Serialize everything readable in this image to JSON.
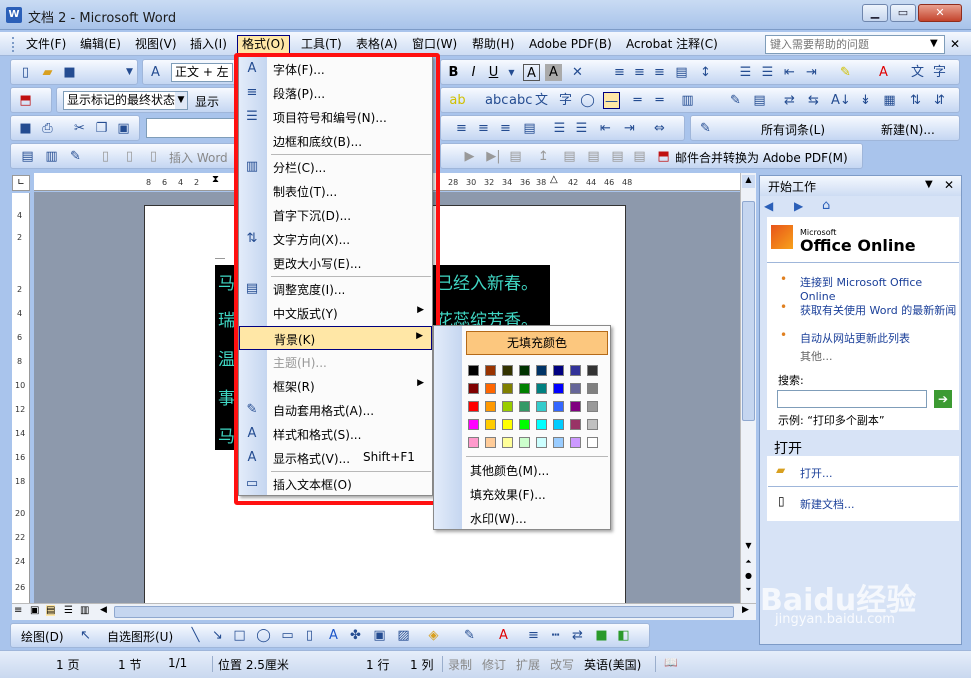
{
  "window": {
    "title": "文档 2 - Microsoft Word",
    "app_icon": "W"
  },
  "menubar": {
    "items": [
      "文件(F)",
      "编辑(E)",
      "视图(V)",
      "插入(I)",
      "格式(O)",
      "工具(T)",
      "表格(A)",
      "窗口(W)",
      "帮助(H)",
      "Adobe PDF(B)",
      "Acrobat 注释(C)"
    ],
    "help_placeholder": "键入需要帮助的问题"
  },
  "toolbar": {
    "style_value": "正文 + 左",
    "markup_combo": "显示标记的最终状态",
    "show_button": "显示",
    "all_entries": "所有词条(L)",
    "new_button": "新建(N)...",
    "insert_word": "插入 Word",
    "mail_merge_pdf": "邮件合并转换为 Adobe PDF(M)"
  },
  "ruler": {
    "h_ticks": [
      "8",
      "6",
      "4",
      "2",
      "28",
      "30",
      "32",
      "34",
      "36",
      "38",
      "42",
      "44",
      "46",
      "48"
    ],
    "v_ticks": [
      "4",
      "2",
      "2",
      "4",
      "6",
      "8",
      "10",
      "12",
      "14",
      "16",
      "18",
      "20",
      "22",
      "24",
      "26"
    ]
  },
  "document": {
    "lines": [
      "马",
      "瑞",
      "温",
      "事",
      "马"
    ],
    "right_fragments": [
      "已经入新春。",
      "花蕊绽芳香。"
    ]
  },
  "format_menu": {
    "items": [
      {
        "label": "字体(F)...",
        "icon": "A"
      },
      {
        "label": "段落(P)...",
        "icon": "≡"
      },
      {
        "label": "项目符号和编号(N)...",
        "icon": "☰"
      },
      {
        "label": "边框和底纹(B)...",
        "icon": ""
      },
      {
        "label": "分栏(C)...",
        "icon": "▥"
      },
      {
        "label": "制表位(T)...",
        "icon": ""
      },
      {
        "label": "首字下沉(D)...",
        "icon": ""
      },
      {
        "label": "文字方向(X)...",
        "icon": "⇅"
      },
      {
        "label": "更改大小写(E)...",
        "icon": ""
      },
      {
        "label": "调整宽度(I)...",
        "icon": "▤"
      },
      {
        "label": "中文版式(Y)",
        "icon": ""
      },
      {
        "label": "背景(K)",
        "icon": ""
      },
      {
        "label": "主题(H)...",
        "icon": ""
      },
      {
        "label": "框架(R)",
        "icon": ""
      },
      {
        "label": "自动套用格式(A)...",
        "icon": "✎"
      },
      {
        "label": "样式和格式(S)...",
        "icon": "A"
      },
      {
        "label": "显示格式(V)...",
        "icon": "A"
      },
      {
        "label": "插入文本框(O)",
        "icon": "▭"
      }
    ],
    "show_format_shortcut": "Shift+F1"
  },
  "background_menu": {
    "no_fill": "无填充颜色",
    "more_colors": "其他颜色(M)...",
    "fill_effects": "填充效果(F)...",
    "watermark": "水印(W)...",
    "swatches": [
      [
        "#000000",
        "#993300",
        "#333300",
        "#003300",
        "#003366",
        "#000080",
        "#333399",
        "#333333"
      ],
      [
        "#800000",
        "#ff6600",
        "#808000",
        "#008000",
        "#008080",
        "#0000ff",
        "#666699",
        "#808080"
      ],
      [
        "#ff0000",
        "#ff9900",
        "#99cc00",
        "#339966",
        "#33cccc",
        "#3366ff",
        "#800080",
        "#999999"
      ],
      [
        "#ff00ff",
        "#ffcc00",
        "#ffff00",
        "#00ff00",
        "#00ffff",
        "#00ccff",
        "#993366",
        "#c0c0c0"
      ],
      [
        "#ff99cc",
        "#ffcc99",
        "#ffff99",
        "#ccffcc",
        "#ccffff",
        "#99ccff",
        "#cc99ff",
        "#ffffff"
      ]
    ]
  },
  "taskpane": {
    "title": "开始工作",
    "brand_small": "Microsoft",
    "brand_large": "Office Online",
    "links": [
      "连接到 Microsoft Office Online",
      "获取有关使用 Word 的最新新闻",
      "自动从网站更新此列表"
    ],
    "more": "其他...",
    "search_label": "搜索:",
    "example": "示例: “打印多个副本”",
    "open_header": "打开",
    "open_link": "打开...",
    "new_doc": "新建文档..."
  },
  "drawbar": {
    "draw": "绘图(D)",
    "autoshapes": "自选图形(U)"
  },
  "statusbar": {
    "page": "1 页",
    "section": "1 节",
    "pages": "1/1",
    "position": "位置 2.5厘米",
    "line": "1 行",
    "col": "1 列",
    "rec": "录制",
    "trk": "修订",
    "ext": "扩展",
    "ovr": "改写",
    "lang": "英语(美国)"
  },
  "watermark": {
    "brand": "Baidu经验",
    "url": "jingyan.baidu.com"
  }
}
